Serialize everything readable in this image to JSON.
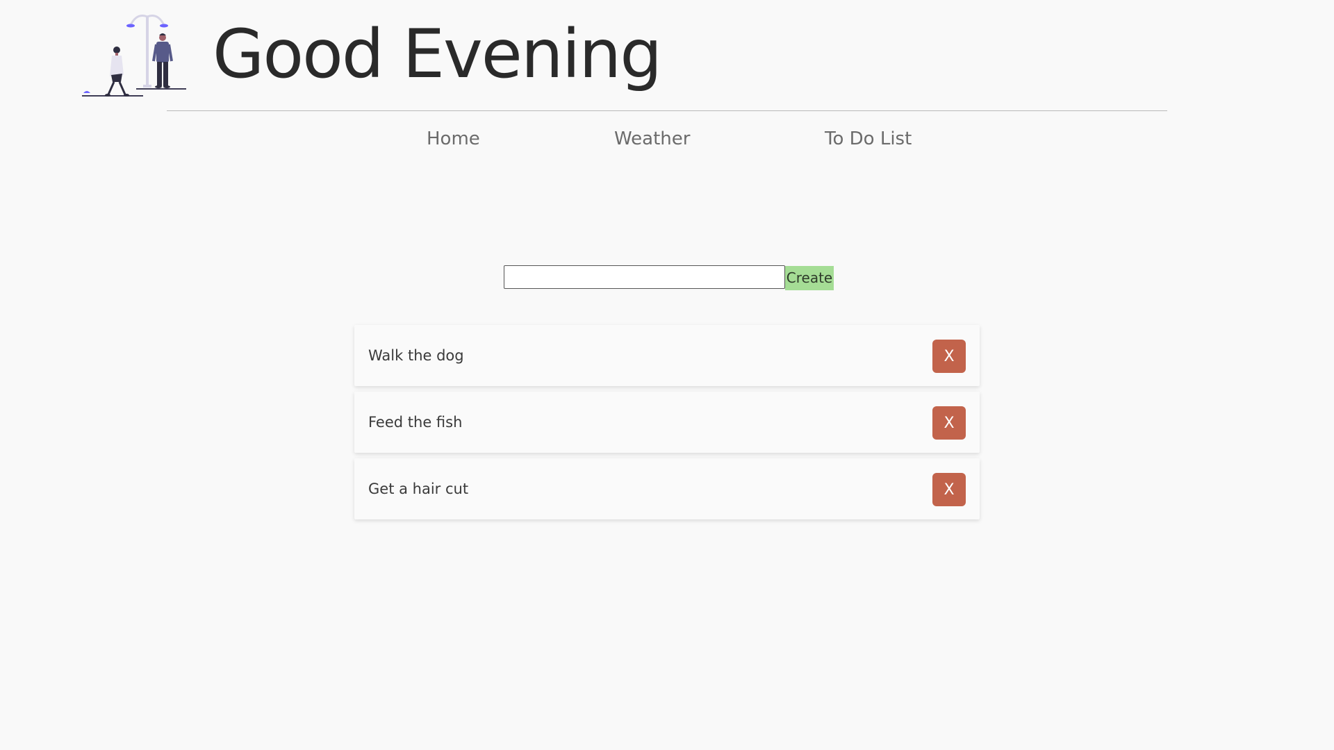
{
  "header": {
    "greeting": "Good Evening"
  },
  "nav": {
    "items": [
      {
        "label": "Home"
      },
      {
        "label": "Weather"
      },
      {
        "label": "To Do List"
      }
    ]
  },
  "todo": {
    "input_value": "",
    "input_placeholder": "",
    "create_label": "Create",
    "delete_label": "X",
    "items": [
      {
        "text": "Walk the dog"
      },
      {
        "text": "Feed the fish"
      },
      {
        "text": "Get a hair cut"
      }
    ]
  },
  "colors": {
    "background": "#f9f9f9",
    "create_button": "#a5dd95",
    "delete_button": "#c2634b",
    "illustration_accent": "#6c63ff"
  }
}
